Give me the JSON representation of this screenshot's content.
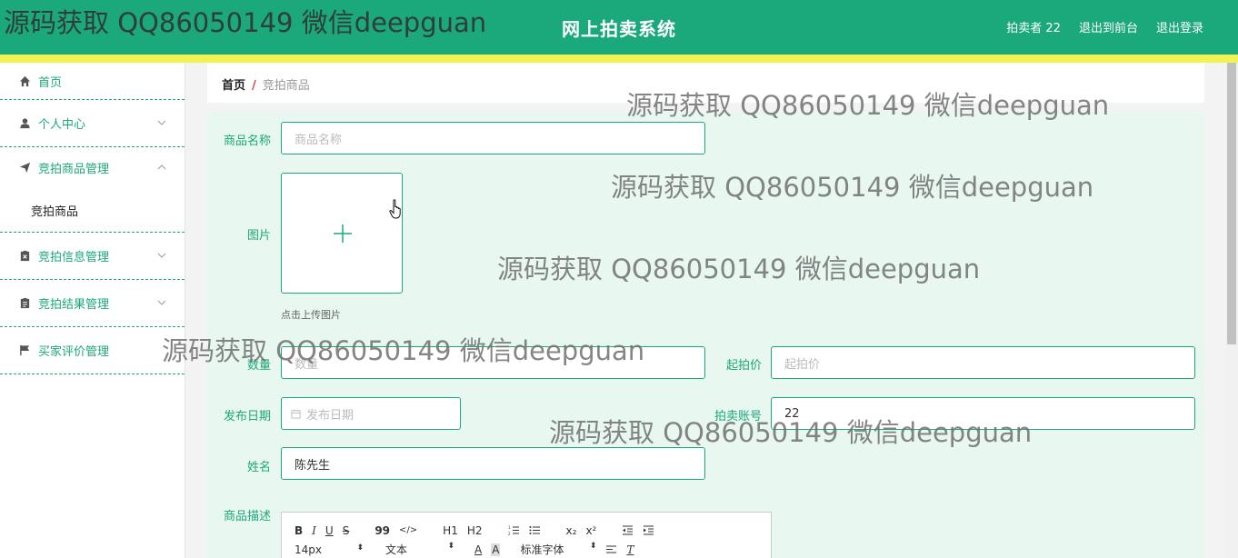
{
  "header": {
    "title": "网上拍卖系统",
    "user": "拍卖者 22",
    "back_to_front": "退出到前台",
    "logout": "退出登录",
    "bg_color": "#1ba87a",
    "stripe_color": "#f0f255"
  },
  "sidebar": {
    "items": [
      {
        "label": "首页",
        "icon": "home-icon"
      },
      {
        "label": "个人中心",
        "icon": "user-icon"
      },
      {
        "label": "竞拍商品管理",
        "icon": "send-icon"
      },
      {
        "label": "竞拍信息管理",
        "icon": "clipboard-x-icon"
      },
      {
        "label": "竞拍结果管理",
        "icon": "clipboard-icon"
      },
      {
        "label": "买家评价管理",
        "icon": "flag-icon"
      }
    ],
    "submenu": {
      "label": "竞拍商品"
    }
  },
  "breadcrumb": {
    "home": "首页",
    "separator": "/",
    "current": "竞拍商品"
  },
  "form": {
    "name": {
      "label": "商品名称",
      "placeholder": "商品名称"
    },
    "image": {
      "label": "图片",
      "hint": "点击上传图片"
    },
    "quantity": {
      "label": "数量",
      "placeholder": "数量"
    },
    "start_price": {
      "label": "起拍价",
      "placeholder": "起拍价"
    },
    "publish_date": {
      "label": "发布日期",
      "placeholder": "发布日期"
    },
    "seller_account": {
      "label": "拍卖账号",
      "value": "22"
    },
    "seller_name": {
      "label": "姓名",
      "value": "陈先生"
    },
    "description": {
      "label": "商品描述"
    }
  },
  "editor": {
    "row1": [
      "B",
      "I",
      "U",
      "S",
      "99",
      "</>",
      "H1",
      "H2",
      "OL",
      "UL",
      "x₂",
      "x²",
      "outdent",
      "indent"
    ],
    "size": "14px",
    "block": "文本",
    "font": "标准字体"
  },
  "watermark": "源码获取 QQ86050149 微信deepguan"
}
